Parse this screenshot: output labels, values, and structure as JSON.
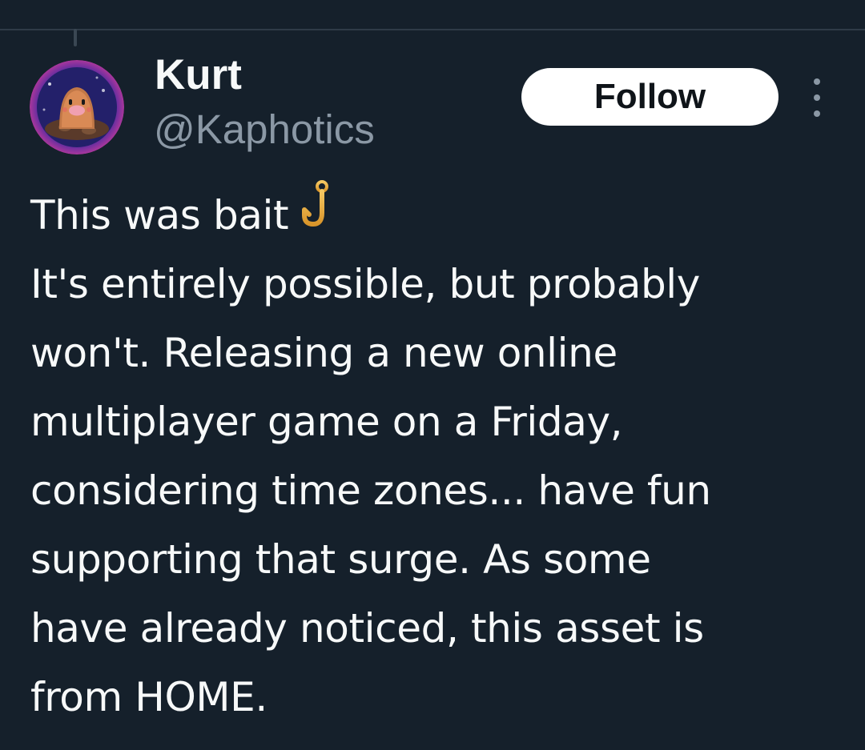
{
  "author": {
    "display_name": "Kurt",
    "handle": "@Kaphotics",
    "avatar_icon": "diglett-avatar"
  },
  "actions": {
    "follow_label": "Follow",
    "more_icon": "more-options-icon"
  },
  "tweet": {
    "lines": [
      "This was bait",
      "It's entirely possible, but probably",
      "won't. Releasing a new online",
      "multiplayer game on a Friday,",
      "considering time zones... have fun",
      "supporting that surge. As some",
      "have already noticed, this asset is",
      "from HOME."
    ],
    "emoji": "fishing-hook-icon"
  },
  "colors": {
    "background": "#15202b",
    "text_primary": "#f7f9f9",
    "text_secondary": "#8b98a5",
    "follow_bg": "#ffffff"
  }
}
